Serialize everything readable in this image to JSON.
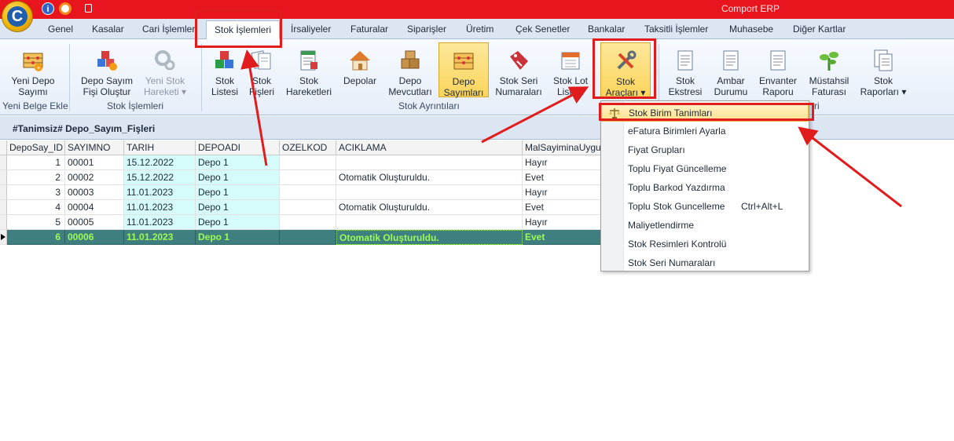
{
  "app": {
    "title": "Comport ERP",
    "logo_letter": "C",
    "info_glyph": "i"
  },
  "tabs": [
    {
      "label": "Genel"
    },
    {
      "label": "Kasalar"
    },
    {
      "label": "Cari İşlemler"
    },
    {
      "label": "Stok İşlemleri",
      "active": true
    },
    {
      "label": "İrsaliyeler"
    },
    {
      "label": "Faturalar"
    },
    {
      "label": "Siparişler"
    },
    {
      "label": "Üretim"
    },
    {
      "label": "Çek Senetler"
    },
    {
      "label": "Bankalar"
    },
    {
      "label": "Taksitli İşlemler"
    },
    {
      "label": "Muhasebe"
    },
    {
      "label": "Diğer Kartlar"
    }
  ],
  "ribbon": {
    "groups": {
      "yeni_belge": {
        "label": "Yeni Belge Ekle"
      },
      "stok_islemleri": {
        "label": "Stok İşlemleri"
      },
      "stok_ayrintilari": {
        "label": "Stok Ayrıntıları"
      },
      "raporlar": {
        "label": "ri"
      }
    },
    "buttons": {
      "yeni_depo_sayimi": {
        "l1": "Yeni Depo",
        "l2": "Sayımı"
      },
      "depo_sayim_fisi": {
        "l1": "Depo Sayım",
        "l2": "Fişi Oluştur"
      },
      "yeni_stok_hareketi": {
        "l1": "Yeni Stok",
        "l2": "Hareketi ▾"
      },
      "stok_listesi": {
        "l1": "Stok",
        "l2": "Listesi"
      },
      "stok_fisleri": {
        "l1": "Stok",
        "l2": "Fişleri"
      },
      "stok_hareketleri": {
        "l1": "Stok",
        "l2": "Hareketleri"
      },
      "depolar": {
        "l1": "Depolar",
        "l2": ""
      },
      "depo_mevcutlari": {
        "l1": "Depo",
        "l2": "Mevcutları"
      },
      "depo_sayimlari": {
        "l1": "Depo",
        "l2": "Sayımları"
      },
      "stok_seri_numaralari": {
        "l1": "Stok Seri",
        "l2": "Numaraları"
      },
      "stok_lot_listesi": {
        "l1": "Stok Lot",
        "l2": "Listesi"
      },
      "stok_araclari": {
        "l1": "Stok",
        "l2": "Araçları ▾"
      },
      "stok_ekstresi": {
        "l1": "Stok",
        "l2": "Ekstresi"
      },
      "ambar_durumu": {
        "l1": "Ambar",
        "l2": "Durumu"
      },
      "envanter_raporu": {
        "l1": "Envanter",
        "l2": "Raporu"
      },
      "mustahsil_faturasi": {
        "l1": "Müstahsil",
        "l2": "Faturası"
      },
      "stok_raporlari": {
        "l1": "Stok",
        "l2": "Raporları ▾"
      }
    }
  },
  "document": {
    "title": "#Tanimsiz# Depo_Sayım_Fişleri"
  },
  "grid": {
    "columns": [
      "DepoSay_ID",
      "SAYIMNO",
      "TARIH",
      "DEPOADI",
      "OZELKOD",
      "ACIKLAMA",
      "MalSayiminaUygun"
    ],
    "rows": [
      {
        "id": "1",
        "sayimno": "00001",
        "tarih": "15.12.2022",
        "depo": "Depo 1",
        "ozelkod": "",
        "aciklama": "",
        "uygun": "Hayır"
      },
      {
        "id": "2",
        "sayimno": "00002",
        "tarih": "15.12.2022",
        "depo": "Depo 1",
        "ozelkod": "",
        "aciklama": "Otomatik Oluşturuldu.",
        "uygun": "Evet"
      },
      {
        "id": "3",
        "sayimno": "00003",
        "tarih": "11.01.2023",
        "depo": "Depo 1",
        "ozelkod": "",
        "aciklama": "",
        "uygun": "Hayır"
      },
      {
        "id": "4",
        "sayimno": "00004",
        "tarih": "11.01.2023",
        "depo": "Depo 1",
        "ozelkod": "",
        "aciklama": "Otomatik Oluşturuldu.",
        "uygun": "Evet"
      },
      {
        "id": "5",
        "sayimno": "00005",
        "tarih": "11.01.2023",
        "depo": "Depo 1",
        "ozelkod": "",
        "aciklama": "",
        "uygun": "Hayır"
      },
      {
        "id": "6",
        "sayimno": "00006",
        "tarih": "11.01.2023",
        "depo": "Depo 1",
        "ozelkod": "",
        "aciklama": "Otomatik Oluşturuldu.",
        "uygun": "Evet",
        "selected": true
      }
    ]
  },
  "dropdown": {
    "items": [
      {
        "label": "Stok Birim Tanimları",
        "highlighted": true,
        "icon": "scale-icon"
      },
      {
        "label": "eFatura Birimleri Ayarla"
      },
      {
        "label": "Fiyat Grupları"
      },
      {
        "label": "Toplu Fiyat Güncelleme"
      },
      {
        "label": "Toplu Barkod Yazdırma"
      },
      {
        "label": "Toplu Stok Guncelleme",
        "shortcut": "Ctrl+Alt+L"
      },
      {
        "label": "Maliyetlendirme"
      },
      {
        "label": "Stok Resimleri Kontrolü"
      },
      {
        "label": "Stok Seri Numaraları"
      }
    ]
  },
  "colors": {
    "title_bar": "#e8141e",
    "annotation_red": "#e11c1c",
    "selected_row": "#3f7f7f",
    "selected_text": "#9cfc54",
    "cyan_cell": "#d5fbfb"
  }
}
